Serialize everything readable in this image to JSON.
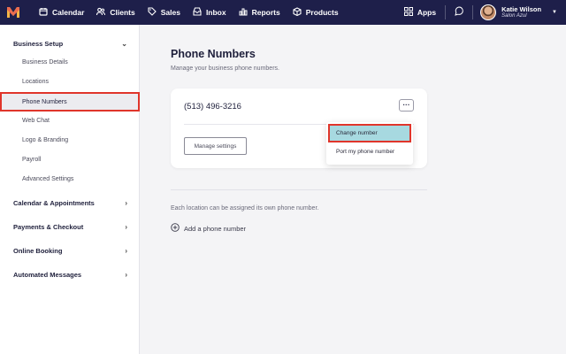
{
  "topbar": {
    "logo_icon": "brand-logo-icon",
    "nav": [
      {
        "label": "Calendar",
        "icon": "calendar-icon"
      },
      {
        "label": "Clients",
        "icon": "clients-icon"
      },
      {
        "label": "Sales",
        "icon": "tag-icon"
      },
      {
        "label": "Inbox",
        "icon": "inbox-icon"
      },
      {
        "label": "Reports",
        "icon": "bar-chart-icon"
      },
      {
        "label": "Products",
        "icon": "box-icon"
      }
    ],
    "apps_label": "Apps",
    "user": {
      "name": "Katie Wilson",
      "salon": "Salon Azul"
    },
    "colors": {
      "background": "#1e1f4a"
    }
  },
  "sidebar": {
    "sections": [
      {
        "label": "Business Setup",
        "expanded": true
      },
      {
        "label": "Calendar & Appointments",
        "expanded": false
      },
      {
        "label": "Payments & Checkout",
        "expanded": false
      },
      {
        "label": "Online Booking",
        "expanded": false
      },
      {
        "label": "Automated Messages",
        "expanded": false
      }
    ],
    "business_setup_items": [
      {
        "label": "Business Details"
      },
      {
        "label": "Locations"
      },
      {
        "label": "Phone Numbers",
        "active": true
      },
      {
        "label": "Web Chat"
      },
      {
        "label": "Logo & Branding"
      },
      {
        "label": "Payroll"
      },
      {
        "label": "Advanced Settings"
      }
    ]
  },
  "main": {
    "title": "Phone Numbers",
    "subtitle": "Manage your business phone numbers.",
    "card": {
      "phone_number": "(513) 496-3216",
      "more_label": "···",
      "manage_label": "Manage settings"
    },
    "menu": {
      "items": [
        {
          "label": "Change number",
          "highlighted": true
        },
        {
          "label": "Port my phone number"
        }
      ]
    },
    "note": "Each location can be assigned its own phone number.",
    "add_label": "Add a phone number"
  },
  "colors": {
    "highlight_border": "#e0352b",
    "menu_highlight": "#a7d9e0"
  }
}
